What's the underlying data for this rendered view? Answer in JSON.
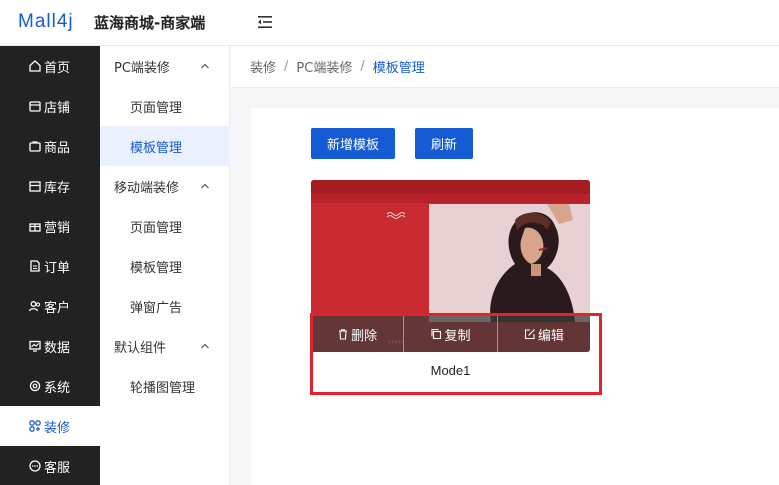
{
  "header": {
    "logo_text": "Mall4j",
    "brand": "蓝海商城-商家端",
    "collapse_icon": "menu-fold-icon"
  },
  "sidebar": {
    "items": [
      {
        "label": "首页",
        "icon": "home-icon"
      },
      {
        "label": "店铺",
        "icon": "shop-icon"
      },
      {
        "label": "商品",
        "icon": "goods-icon"
      },
      {
        "label": "库存",
        "icon": "stock-icon"
      },
      {
        "label": "营销",
        "icon": "gift-icon"
      },
      {
        "label": "订单",
        "icon": "order-icon"
      },
      {
        "label": "客户",
        "icon": "users-icon"
      },
      {
        "label": "数据",
        "icon": "chart-icon"
      },
      {
        "label": "系统",
        "icon": "gear-icon"
      },
      {
        "label": "装修",
        "icon": "decorate-icon",
        "active": true
      },
      {
        "label": "客服",
        "icon": "chat-icon"
      }
    ]
  },
  "subnav": {
    "groups": [
      {
        "label": "PC端装修",
        "items": [
          "页面管理",
          "模板管理"
        ]
      },
      {
        "label": "移动端装修",
        "items": [
          "页面管理",
          "模板管理",
          "弹窗广告"
        ]
      },
      {
        "label": "默认组件",
        "items": [
          "轮播图管理"
        ]
      }
    ],
    "active": "模板管理"
  },
  "breadcrumb": [
    "装修",
    "PC端装修",
    "模板管理"
  ],
  "toolbar": {
    "add_label": "新增模板",
    "refresh_label": "刷新"
  },
  "template_card": {
    "name": "Mode1",
    "actions": {
      "delete_label": "删除",
      "copy_label": "复制",
      "edit_label": "编辑"
    }
  },
  "colors": {
    "accent": "#155bd4",
    "sidebar_bg": "#222222",
    "highlight": "#e0232d",
    "card_red": "#c8242c"
  }
}
